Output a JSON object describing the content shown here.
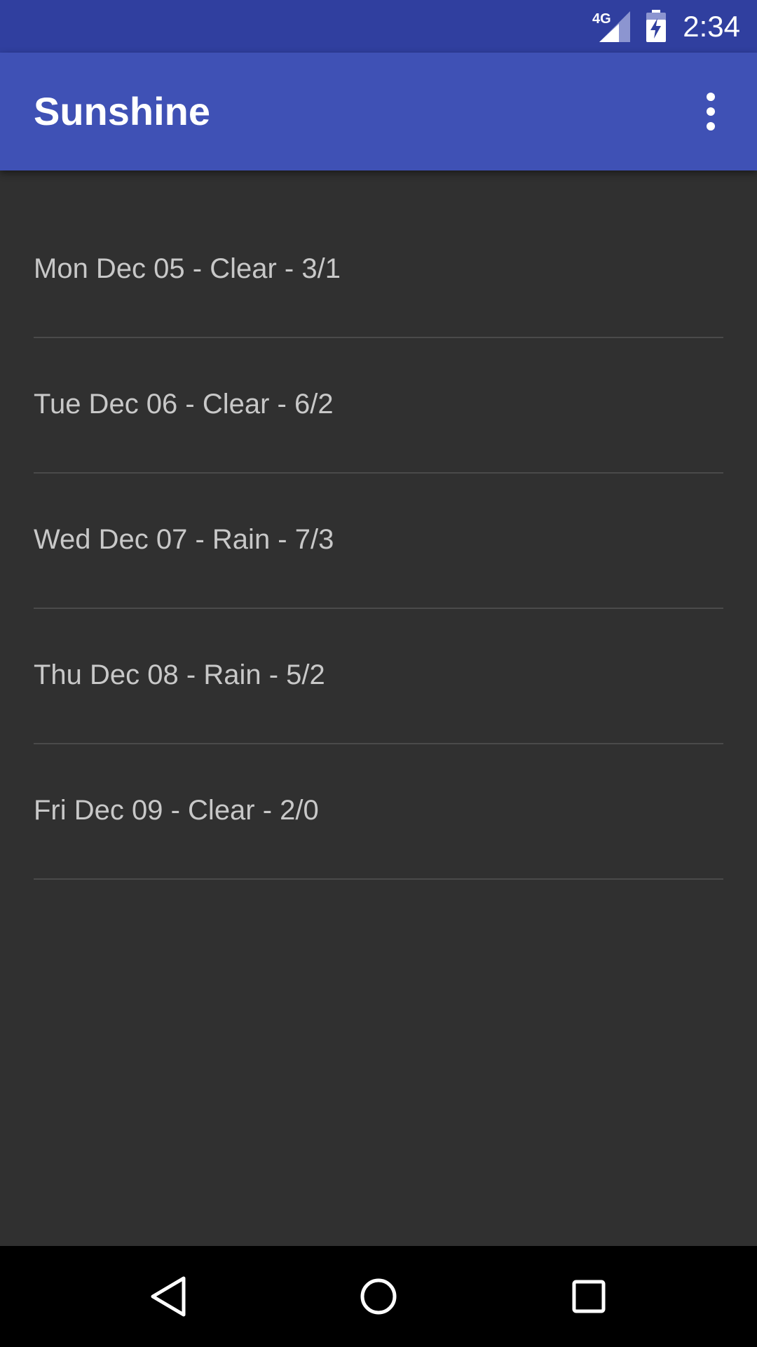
{
  "status_bar": {
    "network_label": "4G",
    "time": "2:34"
  },
  "app_bar": {
    "title": "Sunshine",
    "menu_icon": "overflow-menu-icon"
  },
  "forecast": [
    {
      "label": "Mon Dec 05 - Clear - 3/1"
    },
    {
      "label": "Tue Dec 06 - Clear - 6/2"
    },
    {
      "label": "Wed Dec 07 - Rain - 7/3"
    },
    {
      "label": "Thu Dec 08 - Rain - 5/2"
    },
    {
      "label": "Fri Dec 09 - Clear - 2/0"
    }
  ],
  "nav_bar": {
    "icons": [
      "back-icon",
      "home-icon",
      "recents-icon"
    ]
  },
  "colors": {
    "status_bar": "#303F9F",
    "app_bar": "#3F51B5",
    "background": "#303030",
    "list_text": "#C8C8C8",
    "divider": "#4A4A4A",
    "nav_bar": "#000000"
  }
}
